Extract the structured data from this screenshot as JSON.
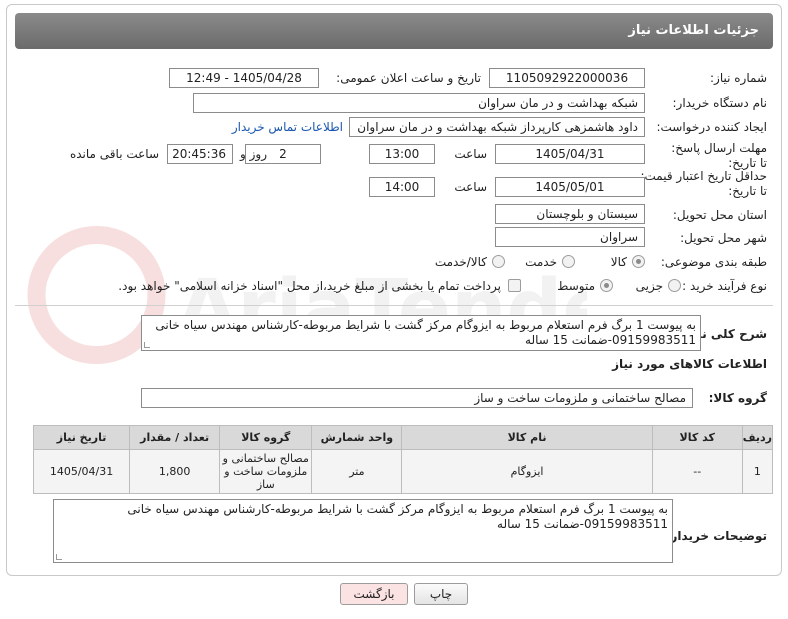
{
  "header": {
    "title": "جزئیات اطلاعات نیاز"
  },
  "fields": {
    "need_number_label": "شماره نیاز:",
    "need_number": "1105092922000036",
    "announce_label": "تاریخ و ساعت اعلان عمومی:",
    "announce_value": "1405/04/28 - 12:49",
    "buyer_org_label": "نام دستگاه خریدار:",
    "buyer_org": "شبکه بهداشت و در مان سراوان",
    "requester_label": "ایجاد کننده درخواست:",
    "requester": "داود هاشمزهی  کارپرداز شبکه بهداشت و در مان سراوان",
    "contact_link": "اطلاعات تماس خریدار",
    "deadline_label": "مهلت ارسال پاسخ: تا تاریخ:",
    "deadline_date": "1405/04/31",
    "time_word": "ساعت",
    "deadline_time": "13:00",
    "days_value": "2",
    "days_word": "روز و",
    "remaining_time": "20:45:36",
    "remaining_word": "ساعت باقی مانده",
    "price_validity_label": "حداقل تاریخ اعتبار قیمت: تا تاریخ:",
    "price_validity_date": "1405/05/01",
    "price_validity_time": "14:00",
    "province_label": "استان محل تحویل:",
    "province": "سیستان و بلوچستان",
    "city_label": "شهر محل تحویل:",
    "city": "سراوان",
    "category_label": "طبقه بندی موضوعی:",
    "category_options": [
      "کالا",
      "خدمت",
      "کالا/خدمت"
    ],
    "process_label": "نوع فرآیند خرید :",
    "process_options": [
      "جزیی",
      "متوسط"
    ],
    "payment_note": "پرداخت تمام یا بخشی از مبلغ خرید،از محل \"اسناد خزانه اسلامی\" خواهد بود."
  },
  "description": {
    "label": "شرح کلی نیاز:",
    "text": "به پیوست 1 برگ فرم استعلام مربوط به ایزوگام مرکز گشت با شرایط مربوطه-کارشناس مهندس سیاه خانی 09159983511-ضمانت 15 ساله"
  },
  "goods_info_title": "اطلاعات کالاهای مورد نیاز",
  "goods_group": {
    "label": "گروه کالا:",
    "value": "مصالح ساختمانی و ملزومات ساخت و ساز"
  },
  "table": {
    "headers": [
      "ردیف",
      "کد کالا",
      "نام کالا",
      "واحد شمارش",
      "گروه کالا",
      "تعداد / مقدار",
      "تاریخ نیاز"
    ],
    "rows": [
      [
        "1",
        "--",
        "ایزوگام",
        "متر",
        "مصالح ساختمانی و ملزومات ساخت و ساز",
        "1,800",
        "1405/04/31"
      ]
    ]
  },
  "buyer_notes": {
    "label": "توضیحات خریدار:",
    "text": "به پیوست 1 برگ فرم استعلام مربوط به ایزوگام مرکز گشت با شرایط مربوطه-کارشناس مهندس سیاه خانی 09159983511-ضمانت 15 ساله"
  },
  "buttons": {
    "print": "چاپ",
    "back": "بازگشت"
  },
  "colors": {
    "header_bg": "#7a7a7a",
    "link": "#1a56b0",
    "back_button_bg": "#fbe3e3"
  }
}
